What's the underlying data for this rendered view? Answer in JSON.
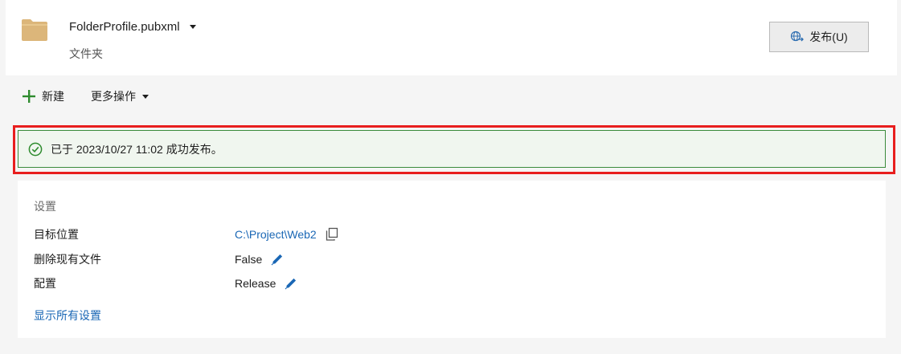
{
  "header": {
    "profile_name": "FolderProfile.pubxml",
    "profile_type": "文件夹",
    "publish_label": "发布(U)"
  },
  "toolbar": {
    "new_label": "新建",
    "more_label": "更多操作"
  },
  "status": {
    "message": "已于 2023/10/27 11:02 成功发布。"
  },
  "settings": {
    "title": "设置",
    "rows": [
      {
        "key": "目标位置",
        "value": "C:\\Project\\Web2"
      },
      {
        "key": "删除现有文件",
        "value": "False"
      },
      {
        "key": "配置",
        "value": "Release"
      }
    ],
    "show_all_label": "显示所有设置"
  },
  "icons": {
    "folder": "folder-icon",
    "publish": "globe-publish-icon",
    "new": "plus-icon",
    "more": "chevron-down-icon",
    "status": "check-circle-icon",
    "copy": "copy-icon",
    "edit": "pencil-icon"
  },
  "colors": {
    "accent": "#1a67b5",
    "success": "#3b8b3b",
    "highlight": "#e81e1e",
    "folder": "#dcb67a"
  }
}
